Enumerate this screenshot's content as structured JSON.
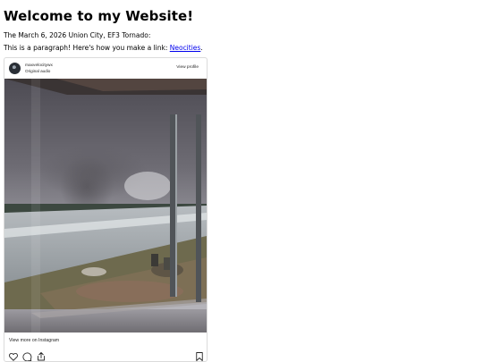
{
  "heading": "Welcome to my Website!",
  "intro": "The March 6, 2026 Union City, EF3 Tornado:",
  "link_sentence": {
    "prefix": "This is a paragraph! Here's how you make a link: ",
    "link_text": "Neocities",
    "suffix": "."
  },
  "instagram": {
    "username": "maxvelocitywx",
    "audio": "Original audio",
    "view_profile": "View profile",
    "view_more": "View more on Instagram",
    "icons": [
      "heart-icon",
      "comment-icon",
      "share-icon",
      "bookmark-icon"
    ]
  }
}
